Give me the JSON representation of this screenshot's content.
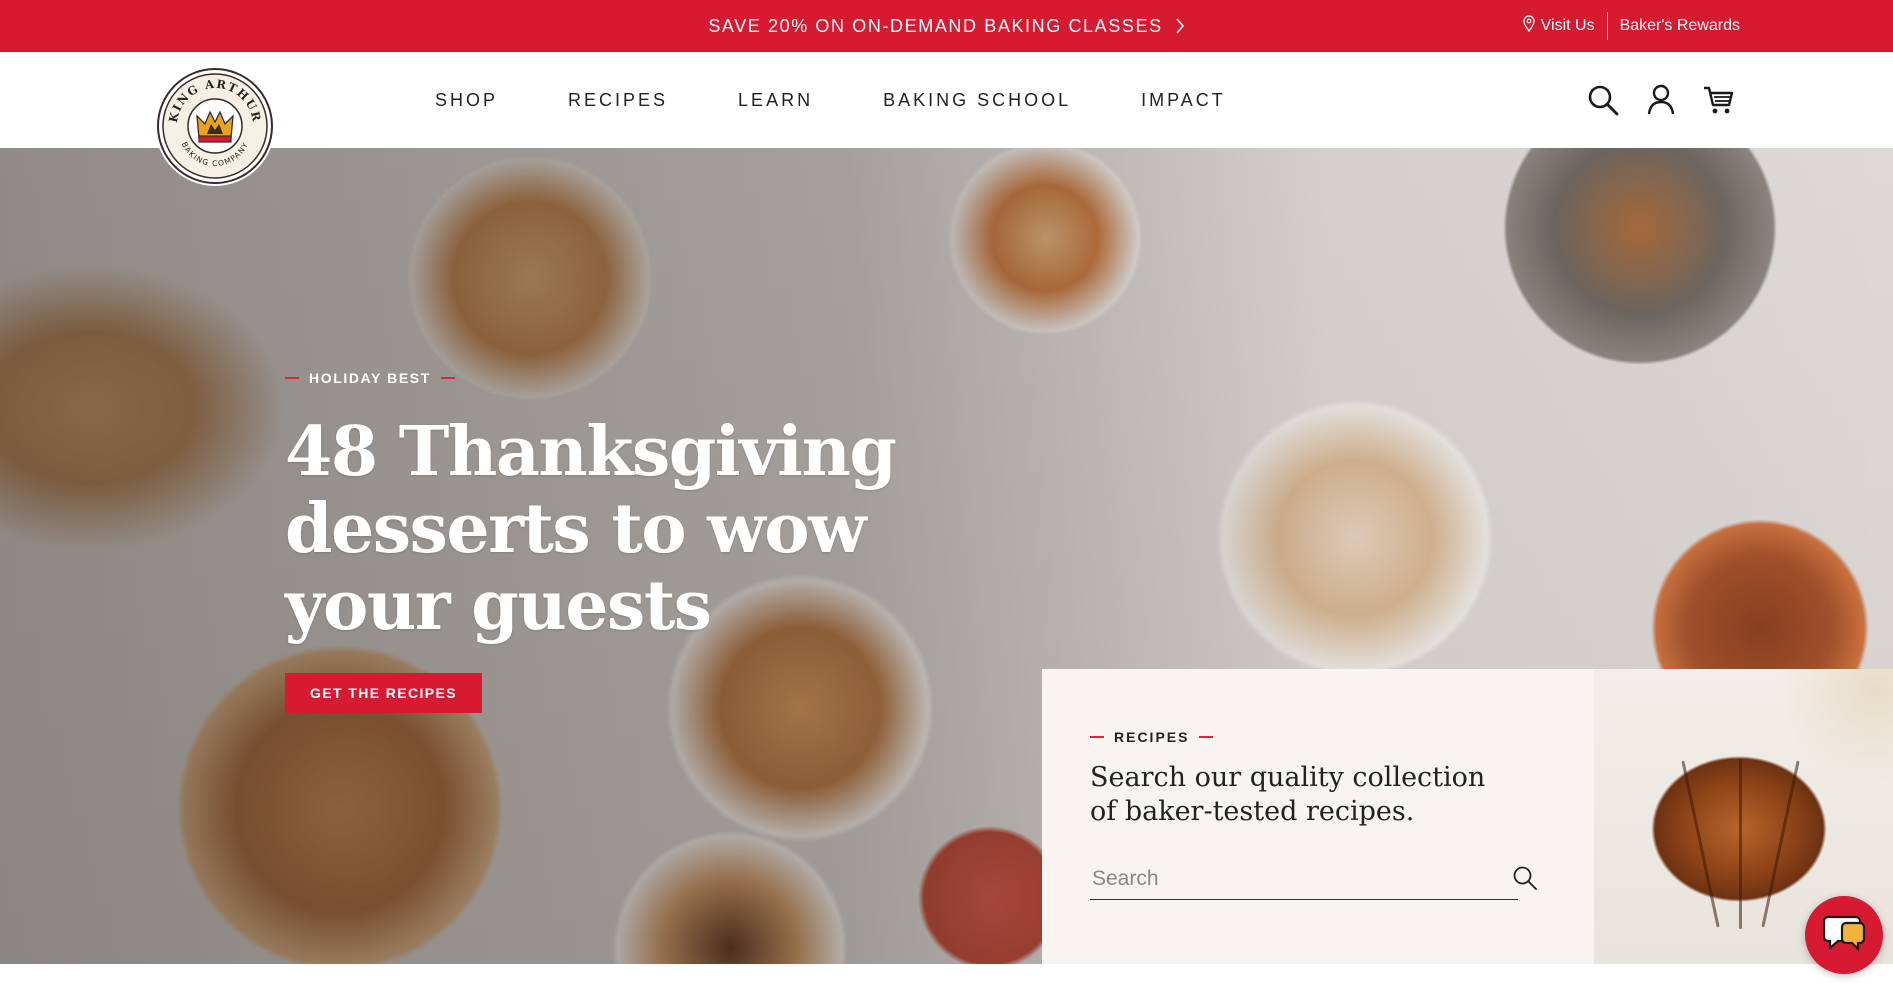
{
  "promo": {
    "text": "SAVE 20% ON ON-DEMAND BAKING CLASSES",
    "visit_us": "Visit Us",
    "rewards": "Baker's Rewards"
  },
  "header": {
    "logo": {
      "top_text": "KING ARTHUR",
      "bottom_text": "BAKING COMPANY"
    },
    "nav": [
      "SHOP",
      "RECIPES",
      "LEARN",
      "BAKING SCHOOL",
      "IMPACT"
    ],
    "icons": [
      "search-icon",
      "account-icon",
      "cart-icon"
    ]
  },
  "hero": {
    "eyebrow": "HOLIDAY BEST",
    "title": "48 Thanksgiving desserts to wow your guests",
    "cta": "GET THE RECIPES"
  },
  "search_card": {
    "eyebrow": "RECIPES",
    "heading": "Search our quality collection of baker-tested recipes.",
    "placeholder": "Search"
  },
  "colors": {
    "brand_red": "#d51a32",
    "card_bg": "#f8f5f1"
  }
}
